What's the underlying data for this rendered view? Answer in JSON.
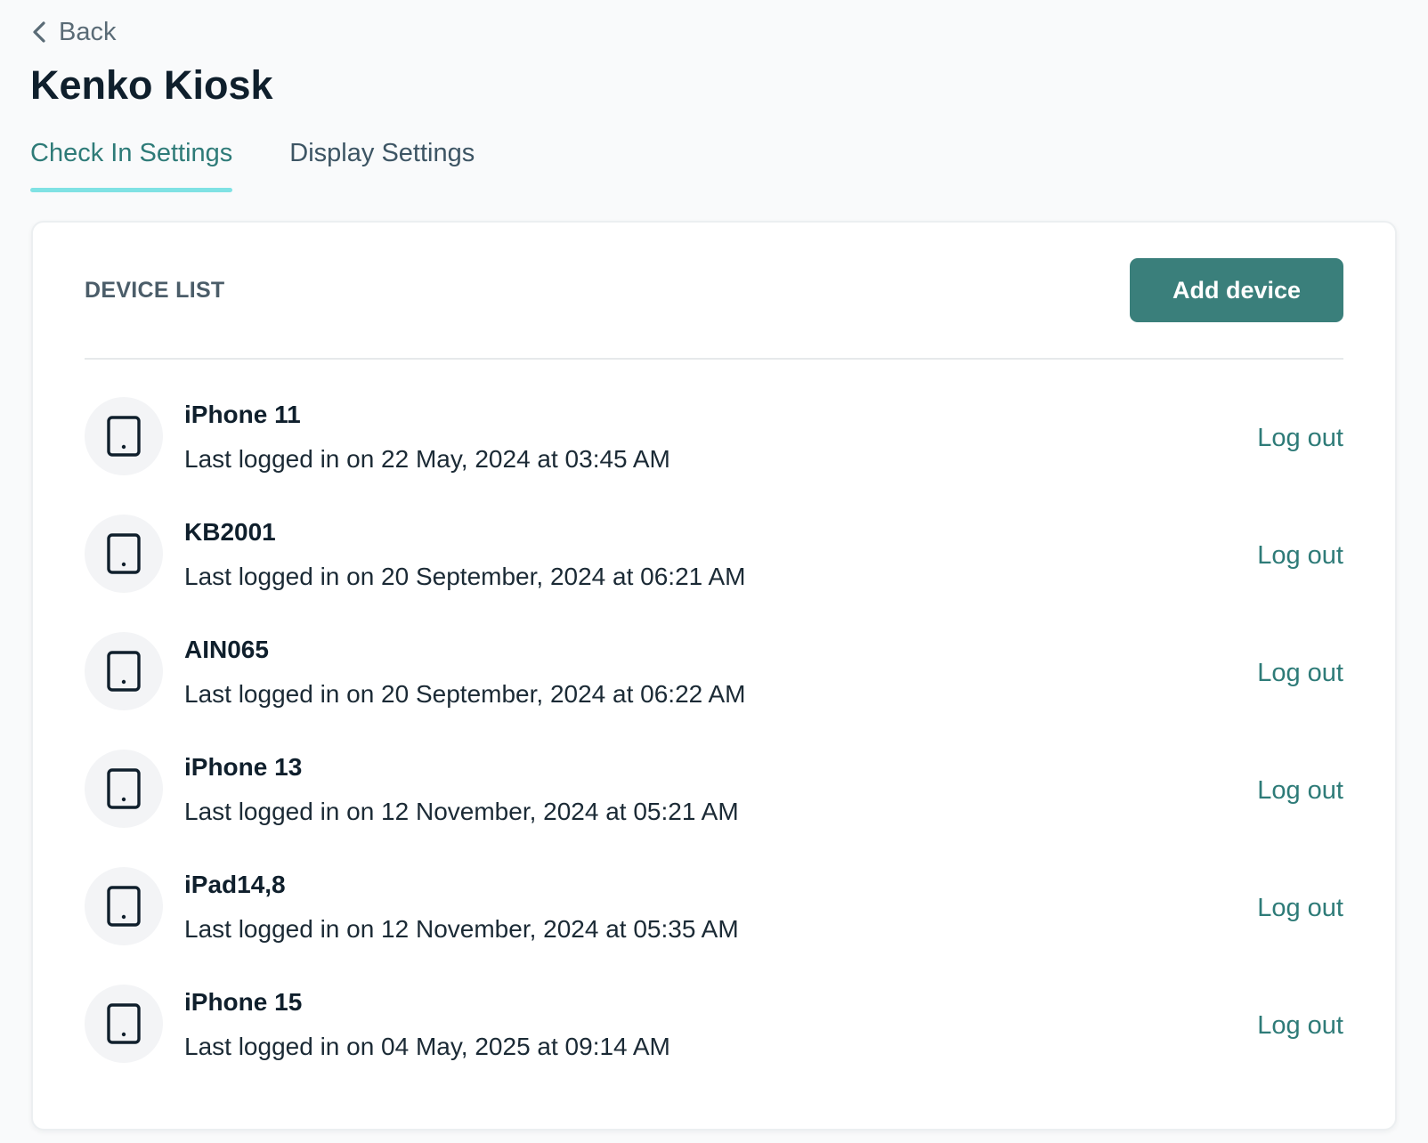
{
  "nav": {
    "back_label": "Back"
  },
  "page": {
    "title": "Kenko Kiosk"
  },
  "tabs": [
    {
      "label": "Check In Settings",
      "active": true
    },
    {
      "label": "Display Settings",
      "active": false
    }
  ],
  "device_section": {
    "title": "DEVICE LIST",
    "add_button_label": "Add device",
    "devices": [
      {
        "name": "iPhone 11",
        "last_login": "Last logged in on 22 May, 2024 at 03:45 AM",
        "action": "Log out"
      },
      {
        "name": "KB2001",
        "last_login": "Last logged in on 20 September, 2024 at 06:21 AM",
        "action": "Log out"
      },
      {
        "name": "AIN065",
        "last_login": "Last logged in on 20 September, 2024 at 06:22 AM",
        "action": "Log out"
      },
      {
        "name": "iPhone 13",
        "last_login": "Last logged in on 12 November, 2024 at 05:21 AM",
        "action": "Log out"
      },
      {
        "name": "iPad14,8",
        "last_login": "Last logged in on 12 November, 2024 at 05:35 AM",
        "action": "Log out"
      },
      {
        "name": "iPhone 15",
        "last_login": "Last logged in on 04 May, 2025 at 09:14 AM",
        "action": "Log out"
      }
    ]
  },
  "icons": {
    "back": "chevron-left-icon",
    "device": "tablet-icon"
  },
  "colors": {
    "accent": "#3a7f7b",
    "link": "#2e7b78",
    "tab_underline": "#80e2e4",
    "background": "#f9fafb",
    "card": "#ffffff"
  }
}
